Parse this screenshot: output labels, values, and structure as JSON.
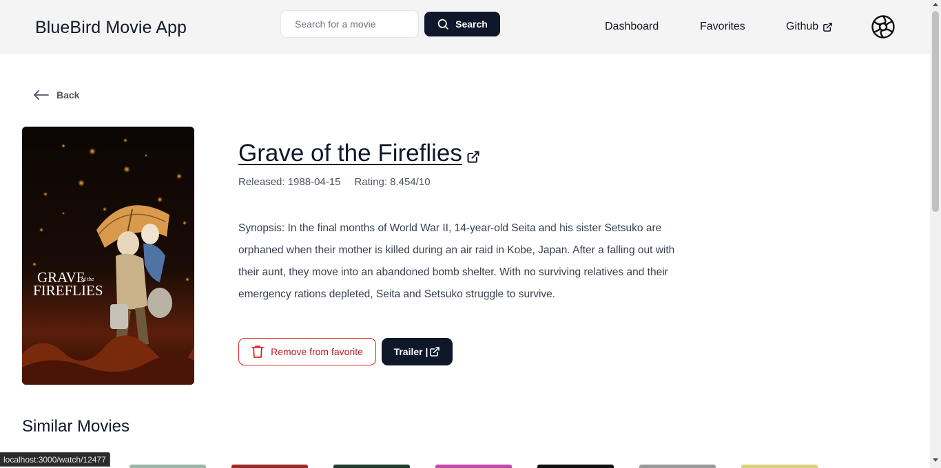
{
  "header": {
    "brand": "BlueBird Movie App",
    "search_placeholder": "Search for a movie",
    "search_button": "Search",
    "nav": {
      "dashboard": "Dashboard",
      "favorites": "Favorites",
      "github": "Github"
    }
  },
  "back_label": "Back",
  "movie": {
    "title": "Grave of the Fireflies",
    "released": "Released: 1988-04-15",
    "rating": "Rating: 8.454/10",
    "synopsis": "Synopsis: In the final months of World War II, 14-year-old Seita and his sister Setsuko are orphaned when their mother is killed during an air raid in Kobe, Japan. After a falling out with their aunt, they move into an abandoned bomb shelter. With no surviving relatives and their emergency rations depleted, Seita and Setsuko struggle to survive.",
    "poster_text_line1": "GRAVE",
    "poster_text_of": "of the",
    "poster_text_line2": "FIREFLIES"
  },
  "actions": {
    "remove_favorite": "Remove from favorite",
    "trailer": "Trailer |"
  },
  "similar_title": "Similar Movies",
  "status_url": "localhost:3000/watch/12477",
  "icons": {
    "search": "search-icon",
    "external_link": "external-link-icon",
    "logo": "aperture-logo-icon",
    "back": "arrow-left-icon",
    "trash": "trash-icon"
  },
  "colors": {
    "primary": "#0f172a",
    "danger": "#dc2626",
    "header_bg": "#f4f4f5"
  }
}
